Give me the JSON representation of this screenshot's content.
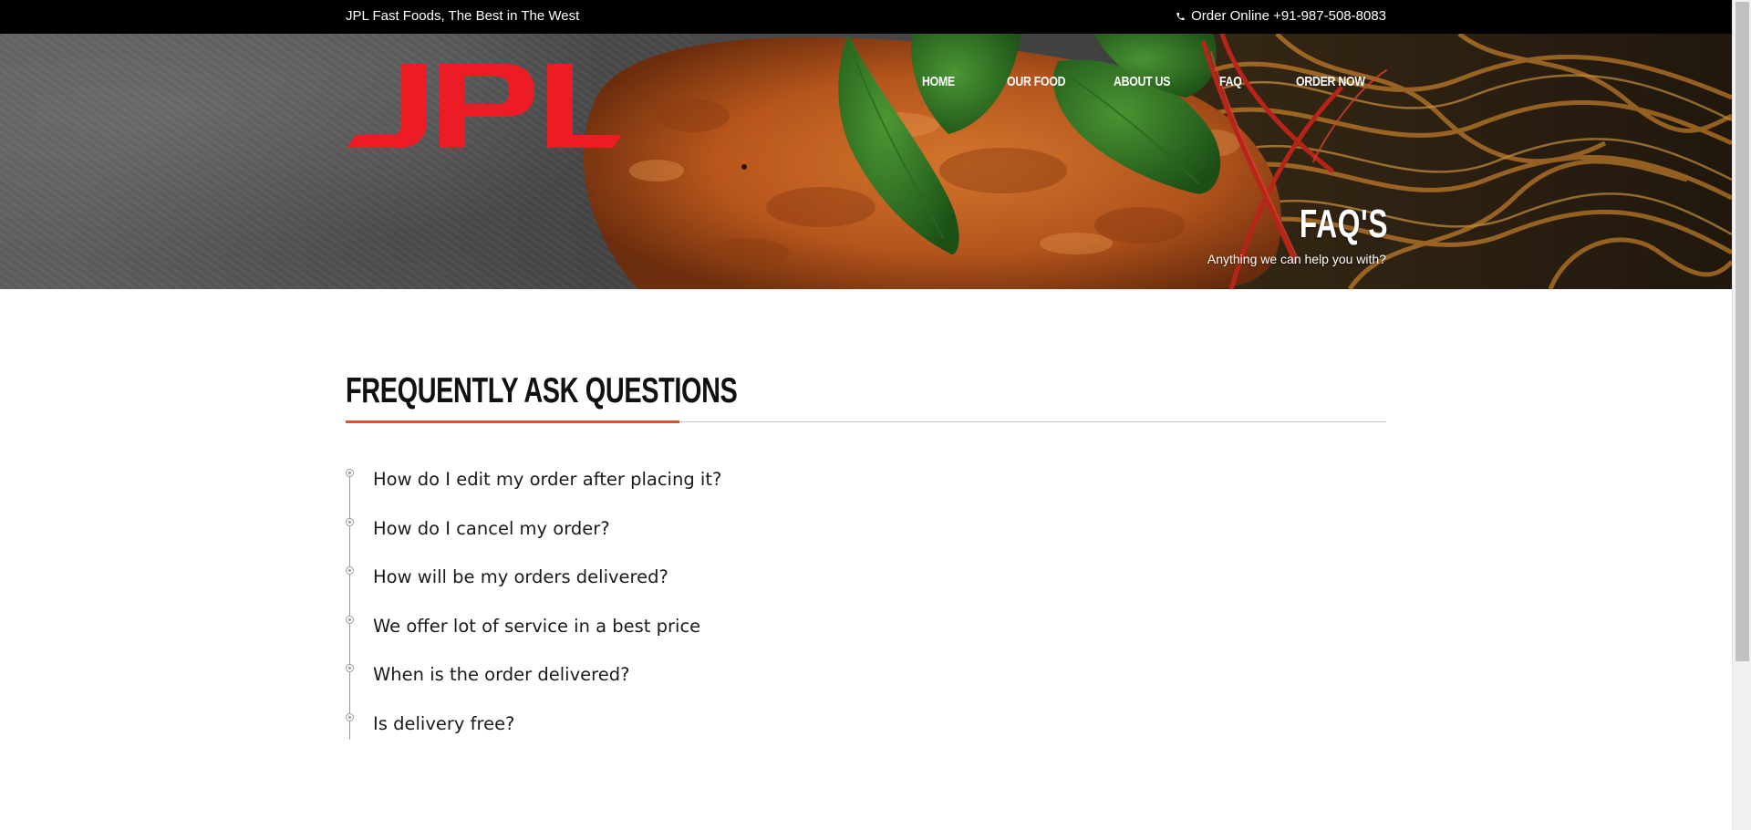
{
  "topbar": {
    "tagline": "JPL Fast Foods, The Best in The West",
    "order_text": "Order Online +91-987-508-8083",
    "phone_icon": "phone-icon"
  },
  "brand": {
    "logo_text": "JPL",
    "logo_color": "#ed1c24"
  },
  "nav": {
    "items": [
      {
        "label": "HOME"
      },
      {
        "label": "OUR FOOD"
      },
      {
        "label": "ABOUT US"
      },
      {
        "label": "FAQ"
      },
      {
        "label": "ORDER NOW"
      }
    ]
  },
  "hero": {
    "title": "FAQ'S",
    "subtitle": "Anything we can help you with?"
  },
  "faq": {
    "heading": "FREQUENTLY ASK QUESTIONS",
    "accent_color": "#e0512b",
    "questions": [
      "How do I edit my order after placing it?",
      "How do I cancel my order?",
      "How will be my orders delivered?",
      "We offer lot of service in a best price",
      "When is the order delivered?",
      "Is delivery free?"
    ]
  }
}
